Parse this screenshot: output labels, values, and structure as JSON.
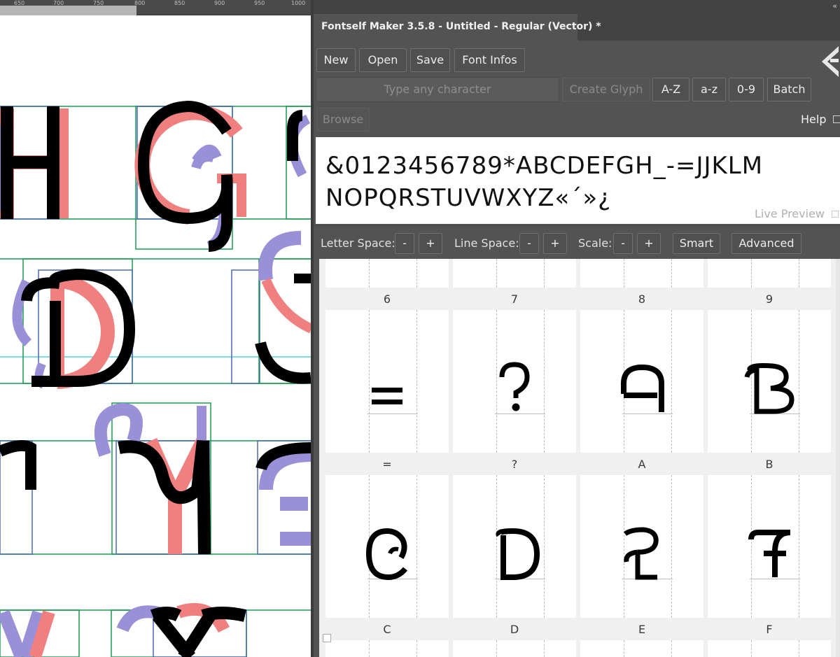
{
  "ruler": {
    "ticks": [
      "650",
      "700",
      "750",
      "800",
      "850",
      "900",
      "950",
      "1000"
    ]
  },
  "panel": {
    "collapse_icon": "double-chevron-left-icon",
    "tab_title": "Fontself Maker 3.5.8 - Untitled - Regular (Vector) *",
    "toolbar": {
      "new": "New",
      "open": "Open",
      "save": "Save",
      "font_infos": "Font Infos"
    },
    "create": {
      "placeholder": "Type any character",
      "create_glyph": "Create Glyph",
      "az_upper": "A-Z",
      "az_lower": "a-z",
      "digits": "0-9",
      "batch": "Batch"
    },
    "browse": "Browse",
    "help": "Help",
    "preview": {
      "text": "&0123456789*ABCDEFGH_-=JJKLMNOPQRSTUVWXYZ«´»¿",
      "live_label": "Live Preview"
    },
    "spacing": {
      "letter_space": "Letter Space:",
      "line_space": "Line Space:",
      "scale": "Scale:",
      "minus": "-",
      "plus": "+",
      "smart": "Smart",
      "advanced": "Advanced"
    },
    "grid": {
      "row0_labels": [
        "6",
        "7",
        "8",
        "9"
      ],
      "row1_labels": [
        "=",
        "?",
        "A",
        "B"
      ],
      "row2_labels": [
        "C",
        "D",
        "E",
        "F"
      ]
    }
  },
  "colors": {
    "panel_bg": "#535353",
    "accent_red": "#f08080",
    "accent_purple": "#9a90d8",
    "guide_green": "#1a9a50",
    "guide_blue": "#4a6ab0",
    "guide_cyan": "#50d0e0"
  }
}
